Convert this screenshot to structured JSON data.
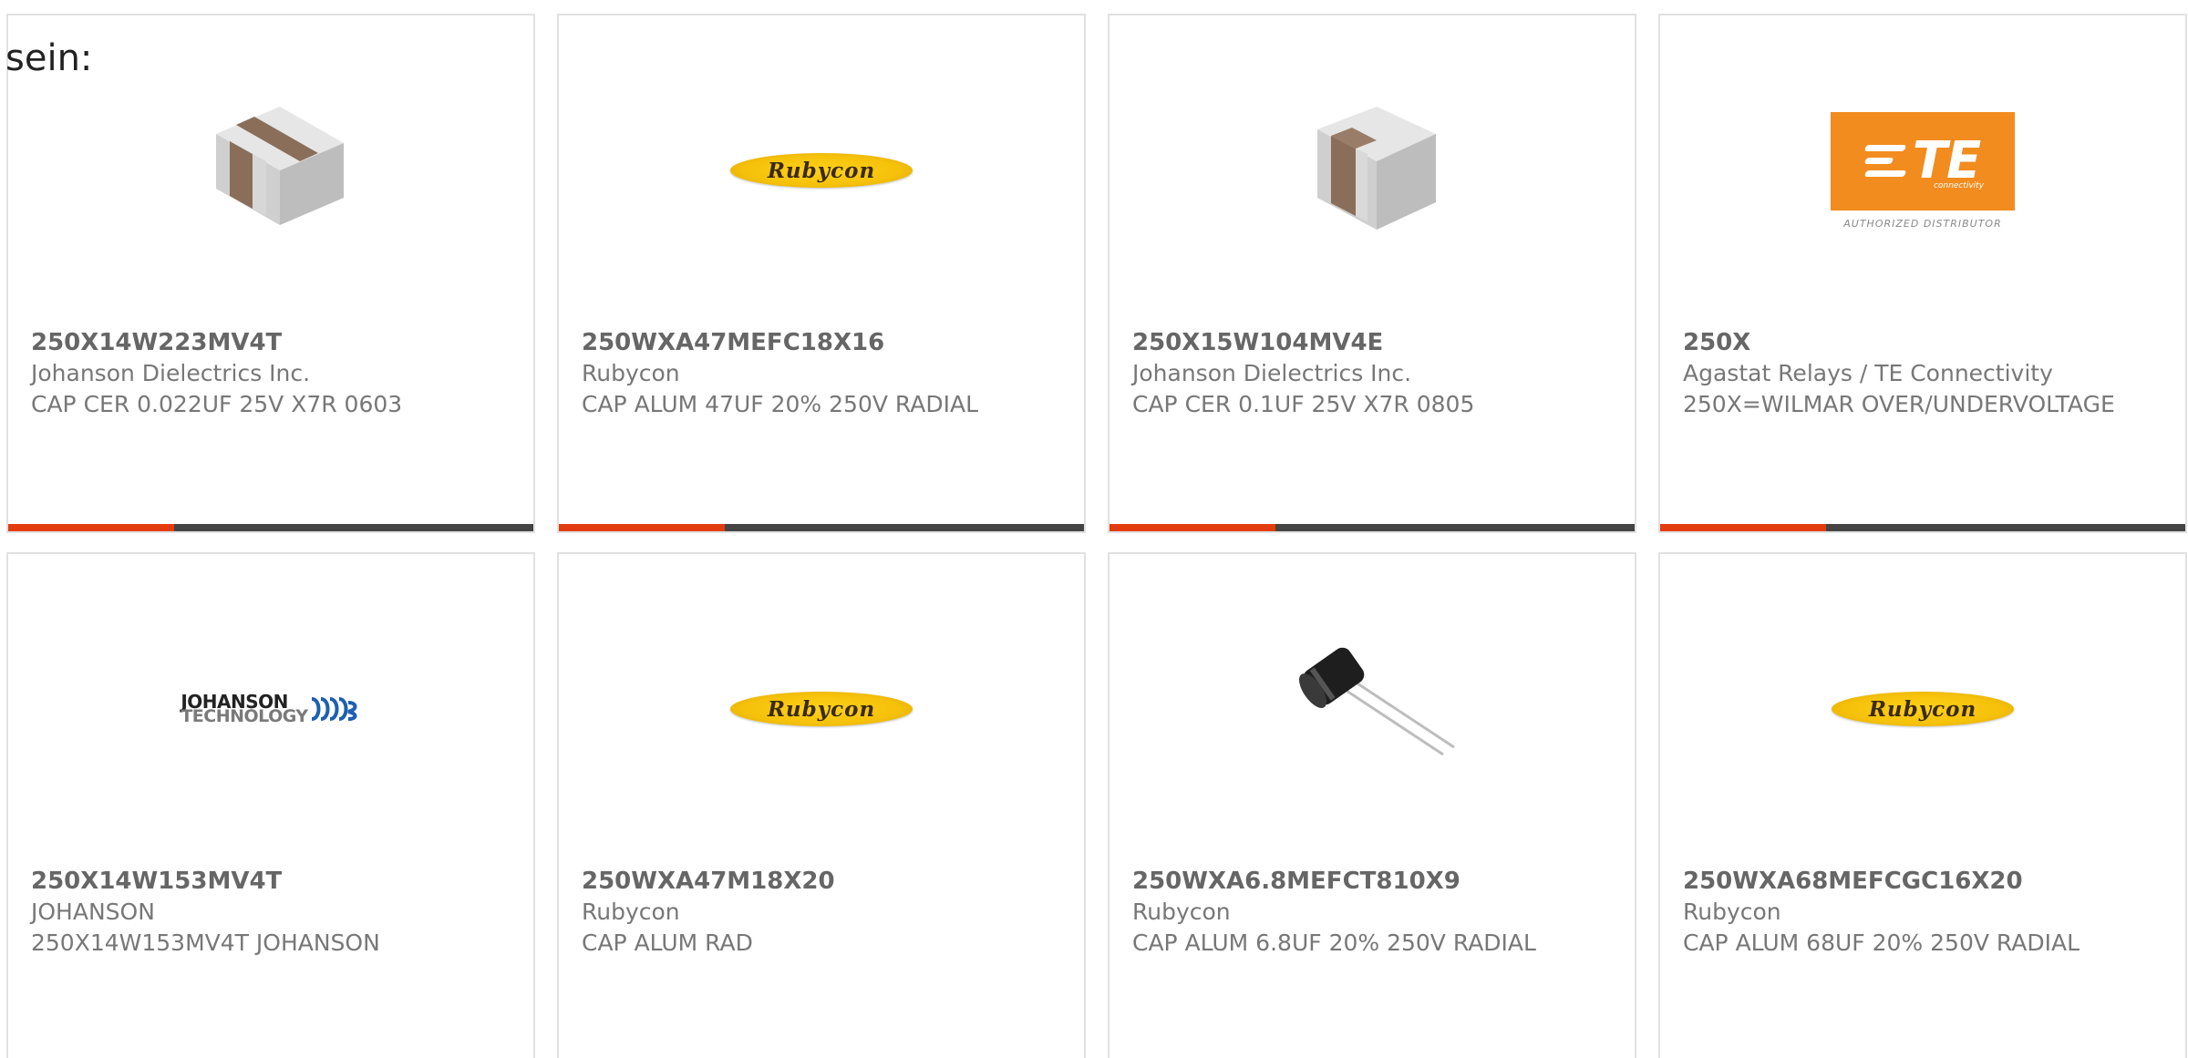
{
  "intro_text": "sein:",
  "colors": {
    "accent": "#e33d0f",
    "bar_dark": "#444444",
    "border": "#e1e1e1"
  },
  "logo_text": {
    "rubycon": "Rubycon",
    "te_main": "TE",
    "te_sub": "connectivity",
    "te_distributor": "AUTHORIZED DISTRIBUTOR",
    "johanson_line1": "JOHANSON",
    "johanson_line2": "TECHNOLOGY"
  },
  "products": [
    {
      "part_number": "250X14W223MV4T",
      "manufacturer": "Johanson Dielectrics Inc.",
      "description": "CAP CER 0.022UF 25V X7R 0603",
      "image_icon": "ceramic-chip-capacitor-icon"
    },
    {
      "part_number": "250WXA47MEFC18X16",
      "manufacturer": "Rubycon",
      "description": "CAP ALUM 47UF 20% 250V RADIAL",
      "image_icon": "rubycon-logo-icon"
    },
    {
      "part_number": "250X15W104MV4E",
      "manufacturer": "Johanson Dielectrics Inc.",
      "description": "CAP CER 0.1UF 25V X7R 0805",
      "image_icon": "ceramic-chip-capacitor-icon"
    },
    {
      "part_number": "250X",
      "manufacturer": "Agastat Relays / TE Connectivity",
      "description": "250X=WILMAR OVER/UNDERVOLTAGE",
      "image_icon": "te-connectivity-logo-icon"
    },
    {
      "part_number": "250X14W153MV4T",
      "manufacturer": "JOHANSON",
      "description": "250X14W153MV4T JOHANSON",
      "image_icon": "johanson-technology-logo-icon"
    },
    {
      "part_number": "250WXA47M18X20",
      "manufacturer": "Rubycon",
      "description": "CAP ALUM RAD",
      "image_icon": "rubycon-logo-icon"
    },
    {
      "part_number": "250WXA6.8MEFCT810X9",
      "manufacturer": "Rubycon",
      "description": "CAP ALUM 6.8UF 20% 250V RADIAL",
      "image_icon": "electrolytic-capacitor-icon"
    },
    {
      "part_number": "250WXA68MEFCGC16X20",
      "manufacturer": "Rubycon",
      "description": "CAP ALUM 68UF 20% 250V RADIAL",
      "image_icon": "rubycon-logo-icon"
    }
  ]
}
